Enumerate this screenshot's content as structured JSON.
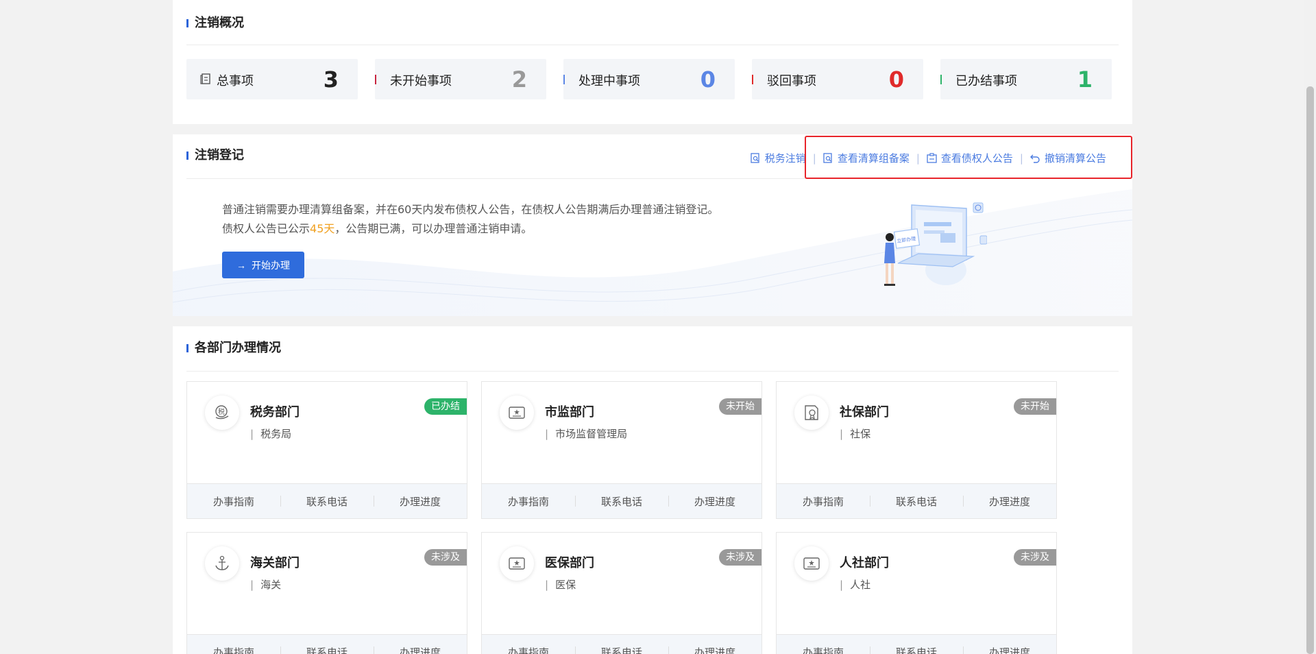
{
  "overview": {
    "title": "注销概况",
    "stats": [
      {
        "label": "总事项",
        "value": "3",
        "color": "#222222",
        "bar": null
      },
      {
        "label": "未开始事项",
        "value": "2",
        "color": "#999999",
        "bar": "#c8243f"
      },
      {
        "label": "处理中事项",
        "value": "0",
        "color": "#5b86e5",
        "bar": "#5b86e5"
      },
      {
        "label": "驳回事项",
        "value": "0",
        "color": "#e02a2a",
        "bar": "#e02a2a"
      },
      {
        "label": "已办结事项",
        "value": "1",
        "color": "#2db36a",
        "bar": "#2db36a"
      }
    ]
  },
  "register": {
    "title": "注销登记",
    "links": [
      {
        "label": "税务注销",
        "icon": "search-doc-icon"
      },
      {
        "label": "查看清算组备案",
        "icon": "search-doc-icon"
      },
      {
        "label": "查看债权人公告",
        "icon": "clipboard-icon"
      },
      {
        "label": "撤销清算公告",
        "icon": "undo-icon"
      }
    ],
    "line1": "普通注销需要办理清算组备案，并在60天内发布债权人公告，在债权人公告期满后办理普通注销登记。",
    "line2_prefix": "债权人公告已公示",
    "line2_highlight": "45天",
    "line2_suffix": "，公告期已满，可以办理普通注销申请。",
    "start_label": "开始办理",
    "illustration_text": "立即办理"
  },
  "depts": {
    "title": "各部门办理情况",
    "footer": [
      "办事指南",
      "联系电话",
      "办理进度"
    ],
    "items": [
      {
        "name": "税务部门",
        "org": "税务局",
        "status": "已办结",
        "status_color": "#2db36a",
        "icon": "tax-icon"
      },
      {
        "name": "市监部门",
        "org": "市场监督管理局",
        "status": "未开始",
        "status_color": "#999999",
        "icon": "id-card-icon"
      },
      {
        "name": "社保部门",
        "org": "社保",
        "status": "未开始",
        "status_color": "#999999",
        "icon": "certificate-icon"
      },
      {
        "name": "海关部门",
        "org": "海关",
        "status": "未涉及",
        "status_color": "#999999",
        "icon": "anchor-icon"
      },
      {
        "name": "医保部门",
        "org": "医保",
        "status": "未涉及",
        "status_color": "#999999",
        "icon": "id-card-icon"
      },
      {
        "name": "人社部门",
        "org": "人社",
        "status": "未涉及",
        "status_color": "#999999",
        "icon": "id-card-icon"
      }
    ]
  }
}
